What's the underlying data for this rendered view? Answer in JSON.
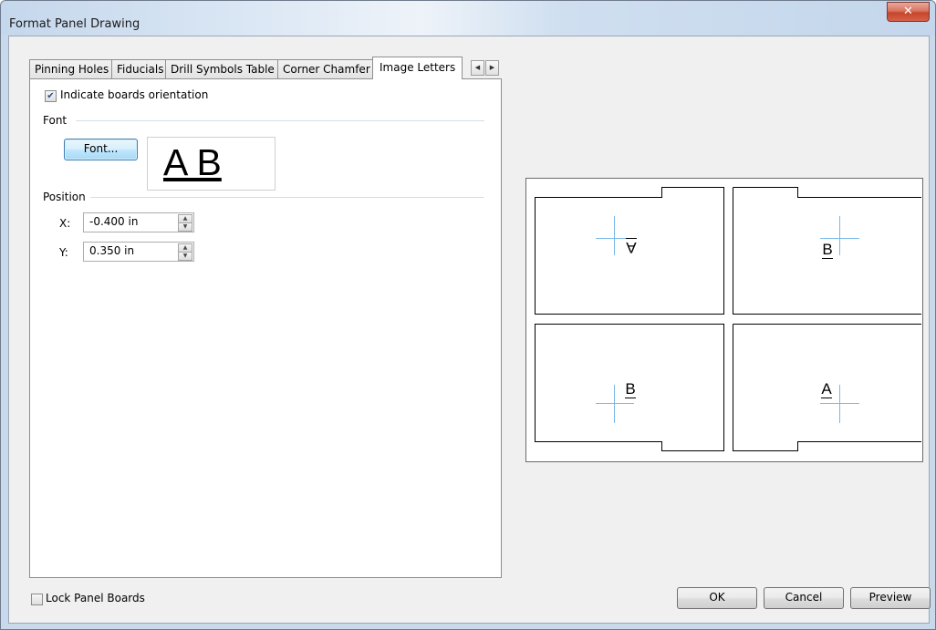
{
  "window": {
    "title": "Format Panel Drawing",
    "close_glyph": "✕"
  },
  "tabs": [
    {
      "label": "Pinning Holes"
    },
    {
      "label": "Fiducials"
    },
    {
      "label": "Drill Symbols Table"
    },
    {
      "label": "Corner Chamfer"
    },
    {
      "label": "Image Letters",
      "active": true
    }
  ],
  "tab_scroll": {
    "left": "◀",
    "right": "▶"
  },
  "orientation": {
    "label": "Indicate boards orientation",
    "checked": true,
    "check_glyph": "✔"
  },
  "font_group": {
    "label": "Font",
    "button_label": "Font...",
    "preview_text": "A B"
  },
  "position_group": {
    "label": "Position",
    "x_label": "X:",
    "x_value": "-0.400 in",
    "y_label": "Y:",
    "y_value": "0.350 in",
    "spin_up": "▲",
    "spin_down": "▼"
  },
  "preview_boards": [
    {
      "letter": "A",
      "flipped": true
    },
    {
      "letter": "B",
      "flipped": false
    },
    {
      "letter": "B",
      "flipped": false
    },
    {
      "letter": "A",
      "flipped": false
    }
  ],
  "lock_panel": {
    "label": "Lock Panel Boards",
    "checked": false
  },
  "buttons": {
    "ok": "OK",
    "cancel": "Cancel",
    "preview": "Preview"
  },
  "colors": {
    "crosshair": "#7ab8e8",
    "close_button": "#c6452b",
    "accent_button": "#3c7fb1"
  }
}
